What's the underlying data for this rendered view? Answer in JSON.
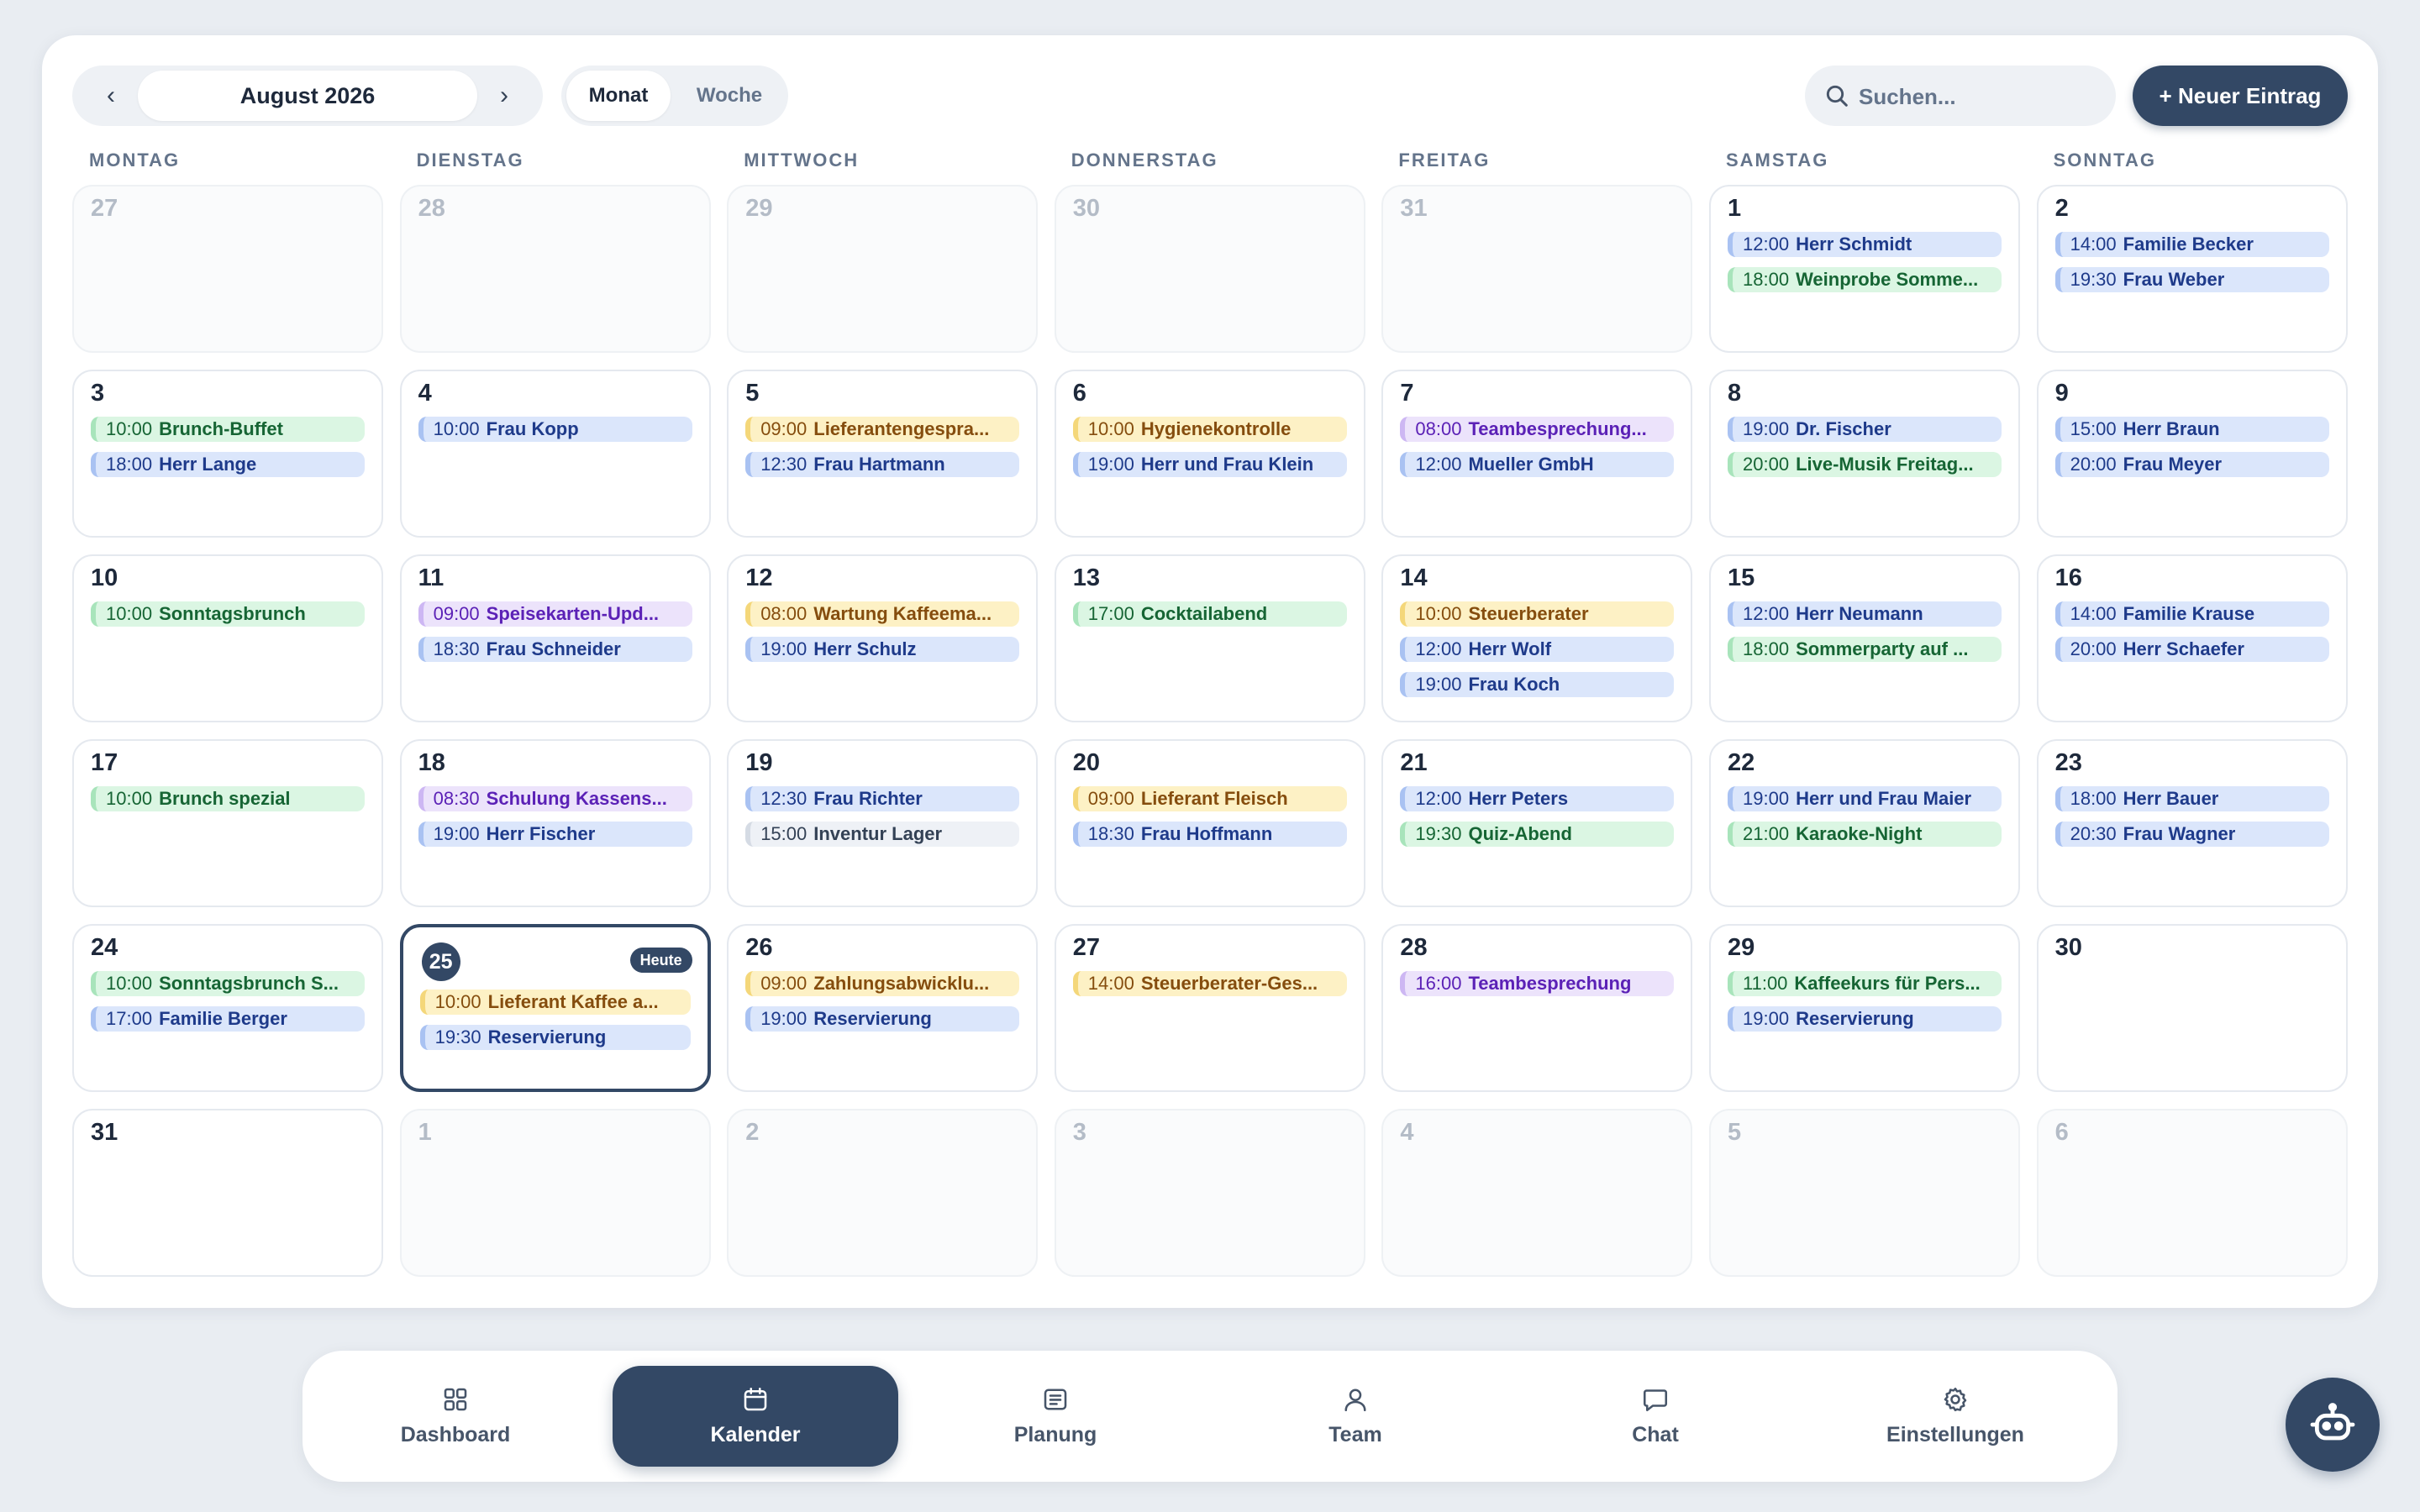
{
  "toolbar": {
    "month_label": "August 2026",
    "prev_icon": "‹",
    "next_icon": "›",
    "view_month": "Monat",
    "view_week": "Woche",
    "search_placeholder": "Suchen...",
    "new_entry_label": "+ Neuer Eintrag"
  },
  "weekdays": [
    "MONTAG",
    "DIENSTAG",
    "MITTWOCH",
    "DONNERSTAG",
    "FREITAG",
    "SAMSTAG",
    "SONNTAG"
  ],
  "today_label": "Heute",
  "event_colors": {
    "blue": "#dbe6fb",
    "green": "#dbf6e3",
    "yellow": "#fdf1c5",
    "purple": "#ece3fb",
    "gray": "#eef1f6"
  },
  "weeks": [
    [
      {
        "day": "27",
        "other": true,
        "events": []
      },
      {
        "day": "28",
        "other": true,
        "events": []
      },
      {
        "day": "29",
        "other": true,
        "events": []
      },
      {
        "day": "30",
        "other": true,
        "events": []
      },
      {
        "day": "31",
        "other": true,
        "events": []
      },
      {
        "day": "1",
        "events": [
          {
            "time": "12:00",
            "title": "Herr Schmidt",
            "color": "blue"
          },
          {
            "time": "18:00",
            "title": "Weinprobe Somme...",
            "color": "green"
          }
        ]
      },
      {
        "day": "2",
        "events": [
          {
            "time": "14:00",
            "title": "Familie Becker",
            "color": "blue"
          },
          {
            "time": "19:30",
            "title": "Frau Weber",
            "color": "blue"
          }
        ]
      }
    ],
    [
      {
        "day": "3",
        "events": [
          {
            "time": "10:00",
            "title": "Brunch-Buffet",
            "color": "green"
          },
          {
            "time": "18:00",
            "title": "Herr Lange",
            "color": "blue"
          }
        ]
      },
      {
        "day": "4",
        "events": [
          {
            "time": "10:00",
            "title": "Frau Kopp",
            "color": "blue"
          }
        ]
      },
      {
        "day": "5",
        "events": [
          {
            "time": "09:00",
            "title": "Lieferantengespra...",
            "color": "yellow"
          },
          {
            "time": "12:30",
            "title": "Frau Hartmann",
            "color": "blue"
          }
        ]
      },
      {
        "day": "6",
        "events": [
          {
            "time": "10:00",
            "title": "Hygienekontrolle",
            "color": "yellow"
          },
          {
            "time": "19:00",
            "title": "Herr und Frau Klein",
            "color": "blue"
          }
        ]
      },
      {
        "day": "7",
        "events": [
          {
            "time": "08:00",
            "title": "Teambesprechung...",
            "color": "purple"
          },
          {
            "time": "12:00",
            "title": "Mueller GmbH",
            "color": "blue"
          }
        ]
      },
      {
        "day": "8",
        "events": [
          {
            "time": "19:00",
            "title": "Dr. Fischer",
            "color": "blue"
          },
          {
            "time": "20:00",
            "title": "Live-Musik Freitag...",
            "color": "green"
          }
        ]
      },
      {
        "day": "9",
        "events": [
          {
            "time": "15:00",
            "title": "Herr Braun",
            "color": "blue"
          },
          {
            "time": "20:00",
            "title": "Frau Meyer",
            "color": "blue"
          }
        ]
      }
    ],
    [
      {
        "day": "10",
        "events": [
          {
            "time": "10:00",
            "title": "Sonntagsbrunch",
            "color": "green"
          }
        ]
      },
      {
        "day": "11",
        "events": [
          {
            "time": "09:00",
            "title": "Speisekarten-Upd...",
            "color": "purple"
          },
          {
            "time": "18:30",
            "title": "Frau Schneider",
            "color": "blue"
          }
        ]
      },
      {
        "day": "12",
        "events": [
          {
            "time": "08:00",
            "title": "Wartung Kaffeema...",
            "color": "yellow"
          },
          {
            "time": "19:00",
            "title": "Herr Schulz",
            "color": "blue"
          }
        ]
      },
      {
        "day": "13",
        "events": [
          {
            "time": "17:00",
            "title": "Cocktailabend",
            "color": "green"
          }
        ]
      },
      {
        "day": "14",
        "events": [
          {
            "time": "10:00",
            "title": "Steuerberater",
            "color": "yellow"
          },
          {
            "time": "12:00",
            "title": "Herr Wolf",
            "color": "blue"
          },
          {
            "time": "19:00",
            "title": "Frau Koch",
            "color": "blue"
          }
        ]
      },
      {
        "day": "15",
        "events": [
          {
            "time": "12:00",
            "title": "Herr Neumann",
            "color": "blue"
          },
          {
            "time": "18:00",
            "title": "Sommerparty auf ...",
            "color": "green"
          }
        ]
      },
      {
        "day": "16",
        "events": [
          {
            "time": "14:00",
            "title": "Familie Krause",
            "color": "blue"
          },
          {
            "time": "20:00",
            "title": "Herr Schaefer",
            "color": "blue"
          }
        ]
      }
    ],
    [
      {
        "day": "17",
        "events": [
          {
            "time": "10:00",
            "title": "Brunch spezial",
            "color": "green"
          }
        ]
      },
      {
        "day": "18",
        "events": [
          {
            "time": "08:30",
            "title": "Schulung Kassens...",
            "color": "purple"
          },
          {
            "time": "19:00",
            "title": "Herr Fischer",
            "color": "blue"
          }
        ]
      },
      {
        "day": "19",
        "events": [
          {
            "time": "12:30",
            "title": "Frau Richter",
            "color": "blue"
          },
          {
            "time": "15:00",
            "title": "Inventur Lager",
            "color": "gray"
          }
        ]
      },
      {
        "day": "20",
        "events": [
          {
            "time": "09:00",
            "title": "Lieferant Fleisch",
            "color": "yellow"
          },
          {
            "time": "18:30",
            "title": "Frau Hoffmann",
            "color": "blue"
          }
        ]
      },
      {
        "day": "21",
        "events": [
          {
            "time": "12:00",
            "title": "Herr Peters",
            "color": "blue"
          },
          {
            "time": "19:30",
            "title": "Quiz-Abend",
            "color": "green"
          }
        ]
      },
      {
        "day": "22",
        "events": [
          {
            "time": "19:00",
            "title": "Herr und Frau Maier",
            "color": "blue"
          },
          {
            "time": "21:00",
            "title": "Karaoke-Night",
            "color": "green"
          }
        ]
      },
      {
        "day": "23",
        "events": [
          {
            "time": "18:00",
            "title": "Herr Bauer",
            "color": "blue"
          },
          {
            "time": "20:30",
            "title": "Frau Wagner",
            "color": "blue"
          }
        ]
      }
    ],
    [
      {
        "day": "24",
        "events": [
          {
            "time": "10:00",
            "title": "Sonntagsbrunch S...",
            "color": "green"
          },
          {
            "time": "17:00",
            "title": "Familie Berger",
            "color": "blue"
          }
        ]
      },
      {
        "day": "25",
        "today": true,
        "events": [
          {
            "time": "10:00",
            "title": "Lieferant Kaffee a...",
            "color": "yellow"
          },
          {
            "time": "19:30",
            "title": "Reservierung",
            "color": "blue"
          }
        ]
      },
      {
        "day": "26",
        "events": [
          {
            "time": "09:00",
            "title": "Zahlungsabwicklu...",
            "color": "yellow"
          },
          {
            "time": "19:00",
            "title": "Reservierung",
            "color": "blue"
          }
        ]
      },
      {
        "day": "27",
        "events": [
          {
            "time": "14:00",
            "title": "Steuerberater-Ges...",
            "color": "yellow"
          }
        ]
      },
      {
        "day": "28",
        "events": [
          {
            "time": "16:00",
            "title": "Teambesprechung",
            "color": "purple"
          }
        ]
      },
      {
        "day": "29",
        "events": [
          {
            "time": "11:00",
            "title": "Kaffeekurs für Pers...",
            "color": "green"
          },
          {
            "time": "19:00",
            "title": "Reservierung",
            "color": "blue"
          }
        ]
      },
      {
        "day": "30",
        "events": []
      }
    ],
    [
      {
        "day": "31",
        "events": []
      },
      {
        "day": "1",
        "other": true,
        "events": []
      },
      {
        "day": "2",
        "other": true,
        "events": []
      },
      {
        "day": "3",
        "other": true,
        "events": []
      },
      {
        "day": "4",
        "other": true,
        "events": []
      },
      {
        "day": "5",
        "other": true,
        "events": []
      },
      {
        "day": "6",
        "other": true,
        "events": []
      }
    ]
  ],
  "bottom_nav": [
    {
      "label": "Dashboard",
      "icon": "grid-icon",
      "active": false
    },
    {
      "label": "Kalender",
      "icon": "calendar-icon",
      "active": true
    },
    {
      "label": "Planung",
      "icon": "document-icon",
      "active": false
    },
    {
      "label": "Team",
      "icon": "person-icon",
      "active": false
    },
    {
      "label": "Chat",
      "icon": "chat-bubble-icon",
      "active": false
    },
    {
      "label": "Einstellungen",
      "icon": "gear-icon",
      "active": false
    }
  ],
  "assistant": {
    "icon": "robot-icon"
  }
}
